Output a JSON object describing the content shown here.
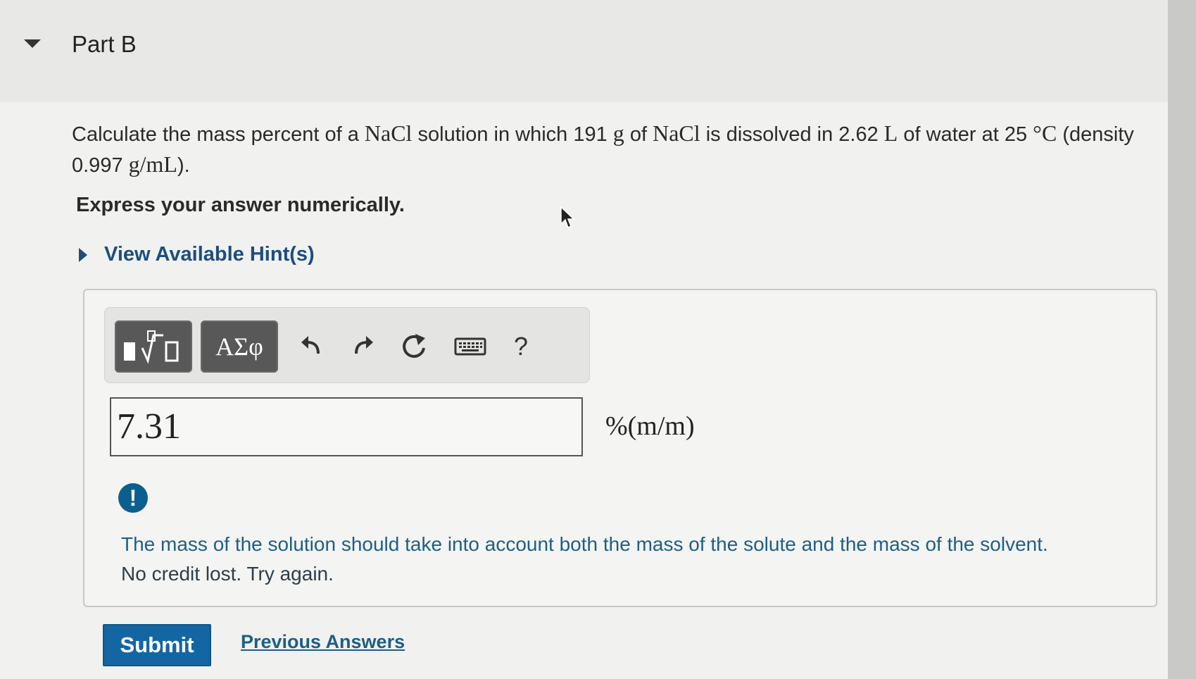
{
  "part": {
    "title": "Part B"
  },
  "question": {
    "text_1": "Calculate the mass percent of a ",
    "solute_1": "NaCl",
    "text_2": " solution in which 191 ",
    "unit_g": "g",
    "text_3": " of ",
    "solute_2": "NaCl",
    "text_4": " is dissolved in 2.62 ",
    "unit_L": "L",
    "text_5": " of water at 25 ",
    "unit_degC": "°C",
    "text_6": " (density 0.997 ",
    "unit_density": "g/mL",
    "text_7": ")."
  },
  "instruction": "Express your answer numerically.",
  "hints": {
    "label": "View Available Hint(s)"
  },
  "toolbar": {
    "greek_label": "ΑΣφ",
    "help_label": "?",
    "icons": [
      "templates-icon",
      "undo-icon",
      "redo-icon",
      "reset-icon",
      "keyboard-icon",
      "help-icon"
    ]
  },
  "answer": {
    "value": "7.31",
    "units": "%(m/m)"
  },
  "feedback": {
    "icon": "alert-icon",
    "line_1": "The mass of the solution should take into account both the mass of the solute and the mass of the solvent.",
    "line_2": "No credit lost. Try again."
  },
  "actions": {
    "submit_label": "Submit",
    "previous_answers_label": "Previous Answers"
  },
  "colors": {
    "accent": "#1466a2",
    "link": "#1d5f86",
    "feedback_text": "#1d5f86",
    "toolbar_button": "#585858"
  }
}
